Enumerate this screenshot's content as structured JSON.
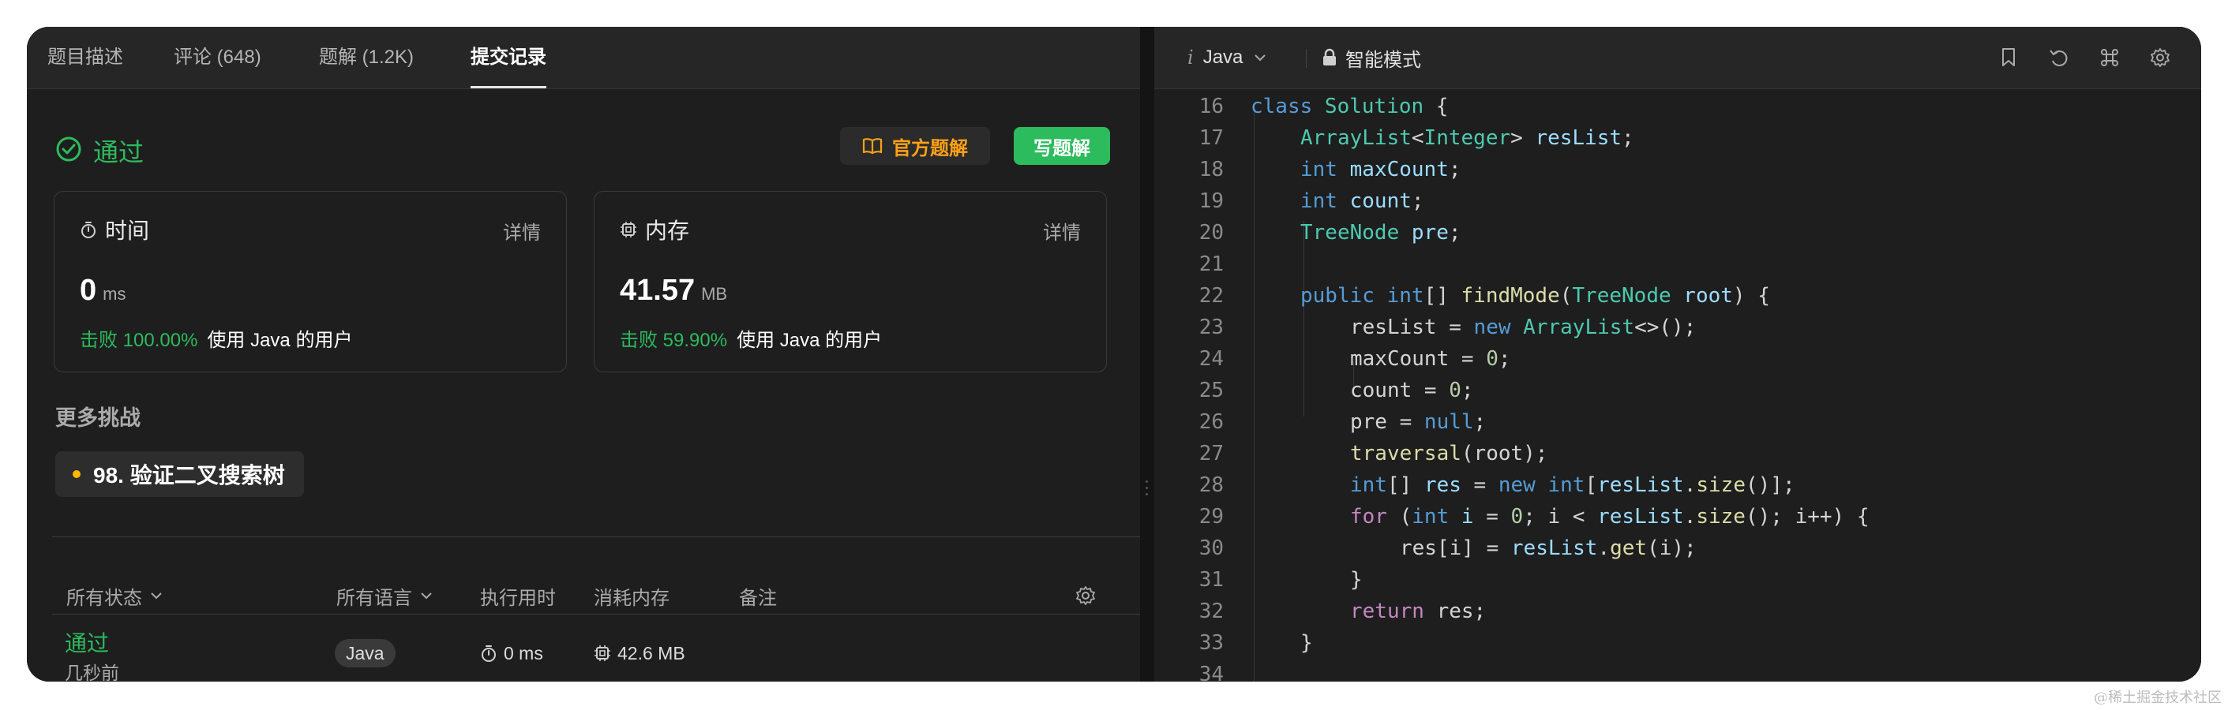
{
  "tabs": [
    "题目描述",
    "评论 (648)",
    "题解 (1.2K)",
    "提交记录"
  ],
  "result": {
    "status": "通过",
    "official_solution_label": "官方题解",
    "write_solution_label": "写题解"
  },
  "runtime": {
    "title": "时间",
    "detail": "详情",
    "value": "0",
    "unit": "ms",
    "beat_pct": "击败 100.00%",
    "beat_text": "使用 Java 的用户"
  },
  "memory": {
    "title": "内存",
    "detail": "详情",
    "value": "41.57",
    "unit": "MB",
    "beat_pct": "击败 59.90%",
    "beat_text": "使用 Java 的用户"
  },
  "more": {
    "title": "更多挑战",
    "problem": "98. 验证二叉搜索树"
  },
  "table": {
    "headers": [
      "所有状态",
      "所有语言",
      "执行用时",
      "消耗内存",
      "备注"
    ],
    "row": {
      "status": "通过",
      "time": "几秒前",
      "lang": "Java",
      "runtime": "0 ms",
      "memory": "42.6 MB"
    }
  },
  "editor": {
    "lang_prefix": "i",
    "language": "Java",
    "mode": "智能模式",
    "lines": [
      {
        "n": "16",
        "indent": 0,
        "tokens": [
          [
            "k",
            "class "
          ],
          [
            "t",
            "Solution"
          ],
          [
            "p",
            " {"
          ]
        ]
      },
      {
        "n": "17",
        "indent": 1,
        "tokens": [
          [
            "t",
            "ArrayList"
          ],
          [
            "p",
            "<"
          ],
          [
            "t",
            "Integer"
          ],
          [
            "p",
            "> "
          ],
          [
            "v",
            "resList"
          ],
          [
            "p",
            ";"
          ]
        ]
      },
      {
        "n": "18",
        "indent": 1,
        "tokens": [
          [
            "k",
            "int "
          ],
          [
            "v",
            "maxCount"
          ],
          [
            "p",
            ";"
          ]
        ]
      },
      {
        "n": "19",
        "indent": 1,
        "tokens": [
          [
            "k",
            "int "
          ],
          [
            "v",
            "count"
          ],
          [
            "p",
            ";"
          ]
        ]
      },
      {
        "n": "20",
        "indent": 1,
        "tokens": [
          [
            "t",
            "TreeNode "
          ],
          [
            "v",
            "pre"
          ],
          [
            "p",
            ";"
          ]
        ]
      },
      {
        "n": "21",
        "indent": 0,
        "tokens": []
      },
      {
        "n": "22",
        "indent": 1,
        "tokens": [
          [
            "k",
            "public "
          ],
          [
            "k",
            "int"
          ],
          [
            "p",
            "[] "
          ],
          [
            "f",
            "findMode"
          ],
          [
            "p",
            "("
          ],
          [
            "t",
            "TreeNode "
          ],
          [
            "v",
            "root"
          ],
          [
            "p",
            ") {"
          ]
        ]
      },
      {
        "n": "23",
        "indent": 2,
        "tokens": [
          [
            "p",
            "resList = "
          ],
          [
            "k",
            "new "
          ],
          [
            "t",
            "ArrayList"
          ],
          [
            "p",
            "<>();"
          ]
        ]
      },
      {
        "n": "24",
        "indent": 2,
        "tokens": [
          [
            "p",
            "maxCount = "
          ],
          [
            "n",
            "0"
          ],
          [
            "p",
            ";"
          ]
        ]
      },
      {
        "n": "25",
        "indent": 2,
        "tokens": [
          [
            "p",
            "count = "
          ],
          [
            "n",
            "0"
          ],
          [
            "p",
            ";"
          ]
        ]
      },
      {
        "n": "26",
        "indent": 2,
        "tokens": [
          [
            "p",
            "pre = "
          ],
          [
            "k",
            "null"
          ],
          [
            "p",
            ";"
          ]
        ]
      },
      {
        "n": "27",
        "indent": 2,
        "tokens": [
          [
            "f",
            "traversal"
          ],
          [
            "p",
            "(root);"
          ]
        ]
      },
      {
        "n": "28",
        "indent": 2,
        "tokens": [
          [
            "k",
            "int"
          ],
          [
            "p",
            "[] "
          ],
          [
            "v",
            "res"
          ],
          [
            "p",
            " = "
          ],
          [
            "k",
            "new "
          ],
          [
            "k",
            "int"
          ],
          [
            "p",
            "["
          ],
          [
            "v",
            "resList"
          ],
          [
            "p",
            "."
          ],
          [
            "f",
            "size"
          ],
          [
            "p",
            "()];"
          ]
        ]
      },
      {
        "n": "29",
        "indent": 2,
        "tokens": [
          [
            "kc",
            "for "
          ],
          [
            "p",
            "("
          ],
          [
            "k",
            "int "
          ],
          [
            "v",
            "i"
          ],
          [
            "p",
            " = "
          ],
          [
            "n",
            "0"
          ],
          [
            "p",
            "; i < "
          ],
          [
            "v",
            "resList"
          ],
          [
            "p",
            "."
          ],
          [
            "f",
            "size"
          ],
          [
            "p",
            "(); i++) {"
          ]
        ]
      },
      {
        "n": "30",
        "indent": 3,
        "tokens": [
          [
            "p",
            "res[i] = "
          ],
          [
            "v",
            "resList"
          ],
          [
            "p",
            "."
          ],
          [
            "f",
            "get"
          ],
          [
            "p",
            "(i);"
          ]
        ]
      },
      {
        "n": "31",
        "indent": 2,
        "tokens": [
          [
            "p",
            "}"
          ]
        ]
      },
      {
        "n": "32",
        "indent": 2,
        "tokens": [
          [
            "kc",
            "return "
          ],
          [
            "p",
            "res;"
          ]
        ]
      },
      {
        "n": "33",
        "indent": 1,
        "tokens": [
          [
            "p",
            "}"
          ]
        ]
      },
      {
        "n": "34",
        "indent": 0,
        "tokens": []
      }
    ]
  },
  "watermark": "@稀土掘金技术社区",
  "colors": {
    "accepted": "#2cbb5d",
    "official": "#ffa116",
    "chip_dot": "#ffb800"
  }
}
